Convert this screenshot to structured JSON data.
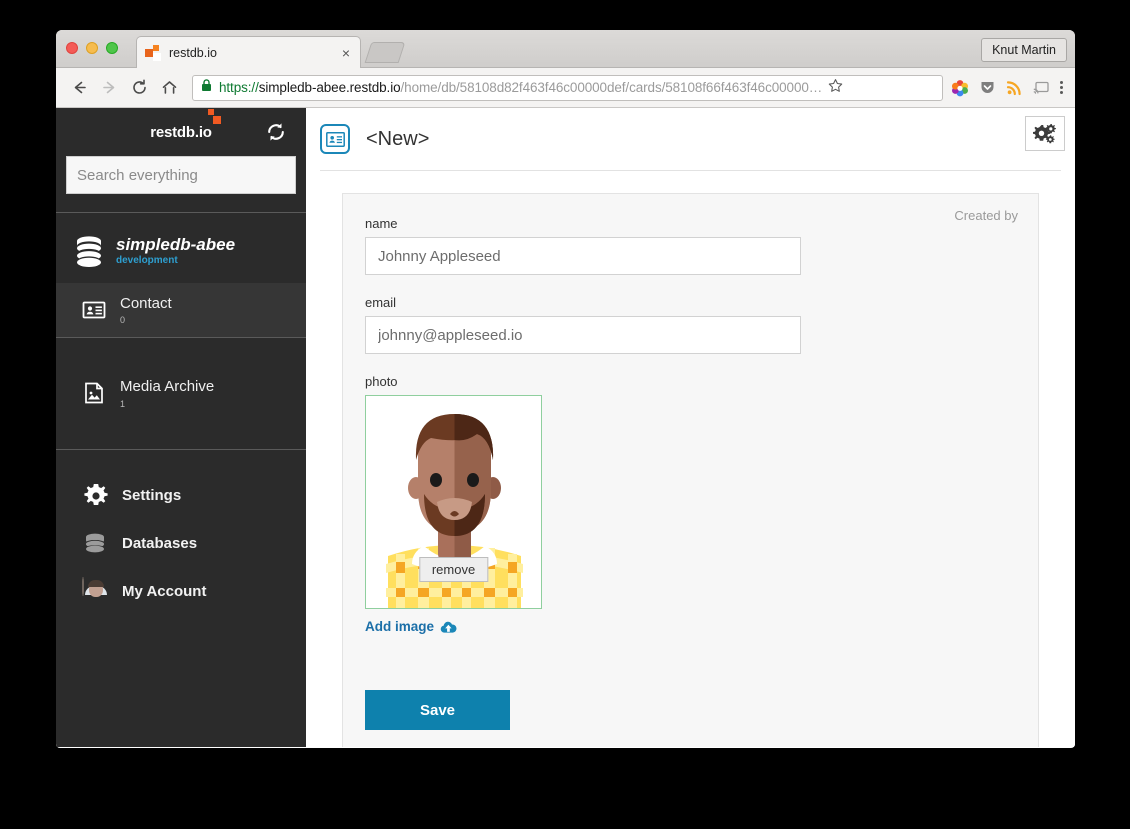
{
  "browser": {
    "tab": {
      "title": "restdb.io",
      "favicon": "restdb-favicon",
      "close_label": "×"
    },
    "profile_button": "Knut Martin",
    "url": {
      "scheme": "https://",
      "host": "simpledb-abee.restdb.io",
      "path": "/home/db/58108d82f463f46c00000def/cards/58108f66f463f46c00000…",
      "full": "https://simpledb-abee.restdb.io/home/db/58108d82f463f46c00000def/cards/58108f66f463f46c00000…"
    },
    "nav": {
      "back": "back-arrow",
      "forward": "forward-arrow",
      "reload": "reload",
      "home": "home"
    },
    "extensions": [
      "colorful-extension-icon",
      "shield-icon",
      "rss-icon",
      "cast-icon"
    ],
    "menu": "chrome-menu"
  },
  "sidebar": {
    "logo": "restdb.io",
    "refresh_title": "refresh",
    "search": {
      "placeholder": "Search everything",
      "value": ""
    },
    "database": {
      "name": "simpledb-abee",
      "environment": "development"
    },
    "collections": [
      {
        "label": "Contact",
        "count": "0",
        "selected": true,
        "icon": "contact-card-icon"
      }
    ],
    "media": {
      "label": "Media Archive",
      "count": "1",
      "icon": "image-file-icon"
    },
    "bottom_items": [
      {
        "label": "Settings",
        "icon": "gear-icon"
      },
      {
        "label": "Databases",
        "icon": "database-icon"
      },
      {
        "label": "My Account",
        "icon": "avatar-icon"
      }
    ]
  },
  "main": {
    "record_icon": "contact-card-icon",
    "title": "<New>",
    "settings_button": "gears-icon",
    "created_by_label": "Created by",
    "fields": [
      {
        "label": "name",
        "value": "Johnny Appleseed",
        "placeholder": ""
      },
      {
        "label": "email",
        "value": "johnny@appleseed.io",
        "placeholder": ""
      }
    ],
    "photo": {
      "label": "photo",
      "remove_label": "remove",
      "add_image_label": "Add image",
      "add_image_icon": "cloud-upload-icon",
      "border_color": "#8fcf9e"
    },
    "save_label": "Save"
  },
  "colors": {
    "accent_blue": "#0e81ad",
    "sidebar_bg": "#2b2b2b",
    "logo_orange": "#f15a22",
    "env_blue": "#2e9fd0",
    "photo_border_green": "#8fcf9e"
  }
}
